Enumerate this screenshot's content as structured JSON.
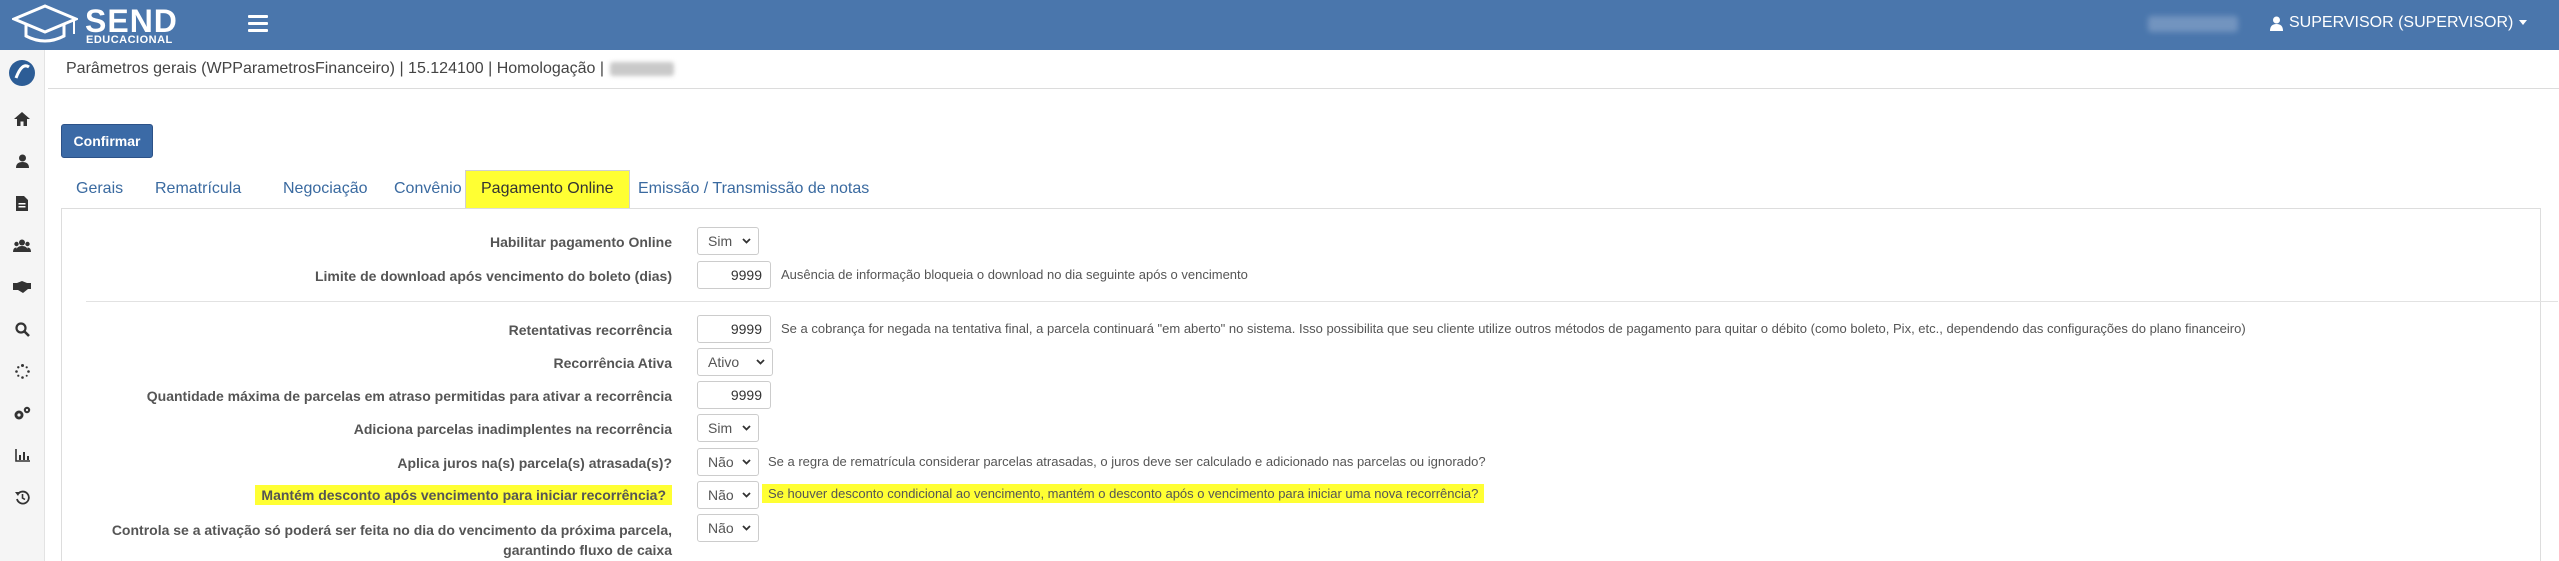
{
  "app": {
    "logo_name": "SEND",
    "logo_sub": "EDUCACIONAL",
    "user_label": "SUPERVISOR (SUPERVISOR)"
  },
  "header": {
    "title": "Parâmetros gerais (WPParametrosFinanceiro) | 15.124100 | Homologação |"
  },
  "toolbar": {
    "confirm_label": "Confirmar"
  },
  "tabs": [
    {
      "label": "Gerais"
    },
    {
      "label": "Rematrícula"
    },
    {
      "label": "Negociação"
    },
    {
      "label": "Convênio"
    },
    {
      "label": "Pagamento Online"
    },
    {
      "label": "Emissão / Transmissão de notas"
    }
  ],
  "form": {
    "rows": [
      {
        "label": "Habilitar pagamento Online",
        "value": "Sim"
      },
      {
        "label": "Limite de download após vencimento do boleto (dias)",
        "value": "9999",
        "hint": "Ausência de informação bloqueia o download no dia seguinte após o vencimento"
      },
      {
        "label": "Retentativas recorrência",
        "value": "9999",
        "hint": "Se a cobrança for negada na tentativa final, a parcela continuará \"em aberto\" no sistema. Isso possibilita que seu cliente utilize outros métodos de pagamento para quitar o débito (como boleto, Pix, etc., dependendo das configurações do plano financeiro)"
      },
      {
        "label": "Recorrência Ativa",
        "value": "Ativo"
      },
      {
        "label": "Quantidade máxima de parcelas em atraso permitidas para ativar a recorrência",
        "value": "9999"
      },
      {
        "label": "Adiciona parcelas inadimplentes na recorrência",
        "value": "Sim"
      },
      {
        "label": "Aplica juros na(s) parcela(s) atrasada(s)?",
        "value": "Não",
        "hint": "Se a regra de rematrícula considerar parcelas atrasadas, o juros deve ser calculado e adicionado nas parcelas ou ignorado?"
      },
      {
        "label": "Mantém desconto após vencimento para iniciar recorrência?",
        "value": "Não",
        "hint": "Se houver desconto condicional ao vencimento, mantém o desconto após o vencimento para iniciar uma nova recorrência?"
      },
      {
        "label_line1": "Controla se a ativação só poderá ser feita no dia do vencimento da próxima parcela,",
        "label_line2": "garantindo fluxo de caixa",
        "value": "Não"
      }
    ]
  },
  "colors": {
    "topbar": "#4a76ac",
    "highlight": "#ffff33",
    "primary_button": "#3b6aa6",
    "tab_text": "#3a6aa0"
  },
  "icons": {
    "sidebar": [
      "app-logo-icon",
      "home-icon",
      "user-icon",
      "document-icon",
      "users-icon",
      "handshake-icon",
      "search-icon",
      "spinner-icon",
      "gears-icon",
      "chart-icon",
      "history-icon"
    ]
  }
}
